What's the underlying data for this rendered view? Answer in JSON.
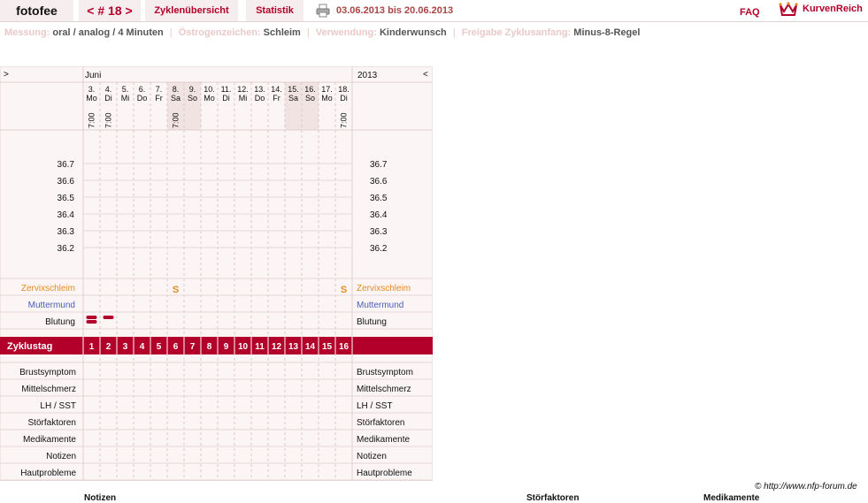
{
  "header": {
    "brand": "fotofee",
    "cycle_nav": "< # 18 >",
    "tabs": [
      {
        "label": "Zyklenübersicht"
      },
      {
        "label": "Statistik"
      }
    ],
    "date_range": "03.06.2013 bis 20.06.2013",
    "faq": "FAQ",
    "logo_text": "KurvenReich",
    "printer_icon": "printer-icon",
    "logo_icon": "crown-logo-icon"
  },
  "info": [
    {
      "label": "Messung:",
      "value": "oral / analog / 4 Minuten"
    },
    {
      "label": "Östrogenzeichen:",
      "value": "Schleim"
    },
    {
      "label": "Verwendung:",
      "value": "Kinderwunsch"
    },
    {
      "label": "Freigabe Zyklusanfang:",
      "value": "Minus-8-Regel"
    }
  ],
  "chart": {
    "nav_left": ">",
    "nav_right": "<",
    "month": "Juni",
    "year": "2013",
    "days": [
      {
        "date": "3.",
        "weekday": "Mo",
        "time": "7:00",
        "weekend": false
      },
      {
        "date": "4.",
        "weekday": "Di",
        "time": "7:00",
        "weekend": false
      },
      {
        "date": "5.",
        "weekday": "Mi",
        "time": "",
        "weekend": false
      },
      {
        "date": "6.",
        "weekday": "Do",
        "time": "",
        "weekend": false
      },
      {
        "date": "7.",
        "weekday": "Fr",
        "time": "",
        "weekend": false
      },
      {
        "date": "8.",
        "weekday": "Sa",
        "time": "7:00",
        "weekend": true
      },
      {
        "date": "9.",
        "weekday": "So",
        "time": "",
        "weekend": true
      },
      {
        "date": "10.",
        "weekday": "Mo",
        "time": "",
        "weekend": false
      },
      {
        "date": "11.",
        "weekday": "Di",
        "time": "",
        "weekend": false
      },
      {
        "date": "12.",
        "weekday": "Mi",
        "time": "",
        "weekend": false
      },
      {
        "date": "13.",
        "weekday": "Do",
        "time": "",
        "weekend": false
      },
      {
        "date": "14.",
        "weekday": "Fr",
        "time": "",
        "weekend": false
      },
      {
        "date": "15.",
        "weekday": "Sa",
        "time": "",
        "weekend": true
      },
      {
        "date": "16.",
        "weekday": "So",
        "time": "",
        "weekend": true
      },
      {
        "date": "17.",
        "weekday": "Mo",
        "time": "",
        "weekend": false
      },
      {
        "date": "18.",
        "weekday": "Di",
        "time": "7:00",
        "weekend": false
      }
    ],
    "temp_labels": [
      "36.7",
      "36.6",
      "36.5",
      "36.4",
      "36.3",
      "36.2"
    ],
    "zervix_label": "Zervixschleim",
    "zervix_marks": [
      {
        "day_index": 5,
        "symbol": "S"
      },
      {
        "day_index": 15,
        "symbol": "S"
      }
    ],
    "muttermund_label": "Muttermund",
    "blutung_label": "Blutung",
    "blutung_marks": [
      {
        "day_index": 0,
        "intensity": 2
      },
      {
        "day_index": 1,
        "intensity": 1
      }
    ],
    "zyklustag_label": "Zyklustag",
    "cycle_days": [
      "1",
      "2",
      "3",
      "4",
      "5",
      "6",
      "7",
      "8",
      "9",
      "10",
      "11",
      "12",
      "13",
      "14",
      "15",
      "16"
    ],
    "symptom_rows": [
      "Brustsymptom",
      "Mittelschmerz",
      "LH / SST",
      "Störfaktoren",
      "Medikamente",
      "Notizen",
      "Hautprobleme"
    ],
    "colors": {
      "accent": "#b3002a",
      "zervix": "#e58a1f",
      "muttermund": "#4a5fb5",
      "grid_bg": "#fbf5f5",
      "weekend": "#f2e3e3"
    }
  },
  "footer": {
    "copyright": "© http://www.nfp-forum.de",
    "labels": [
      "Notizen",
      "Störfaktoren",
      "Medikamente"
    ]
  }
}
